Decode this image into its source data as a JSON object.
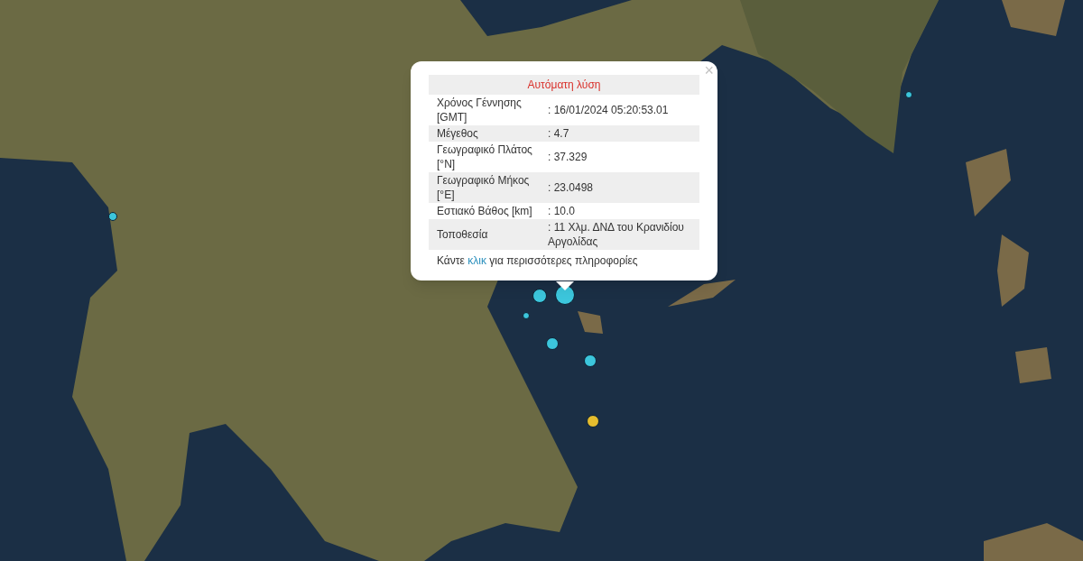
{
  "markers": [
    {
      "color": "#3cc6dc"
    },
    {
      "color": "#3cc6dc"
    },
    {
      "color": "#3cc6dc"
    },
    {
      "color": "#3cc6dc"
    },
    {
      "color": "#3cc6dc"
    },
    {
      "color": "#3cc6dc"
    },
    {
      "color": "#3cc6dc"
    },
    {
      "color": "#e6bd2e"
    }
  ],
  "popup": {
    "close": "×",
    "title": "Αυτόματη λύση",
    "rows": [
      {
        "label": "Χρόνος Γέννησης [GMT]",
        "value": ": 16/01/2024 05:20:53.01"
      },
      {
        "label": "Μέγεθος",
        "value": ": 4.7"
      },
      {
        "label": "Γεωγραφικό Πλάτος [°N]",
        "value": ": 37.329"
      },
      {
        "label": "Γεωγραφικό Μήκος [°E]",
        "value": ": 23.0498"
      },
      {
        "label": "Εστιακό Βάθος [km]",
        "value": ": 10.0"
      },
      {
        "label": "Τοποθεσία",
        "value": ": 11 Χλμ. ΔΝΔ του Κρανιδίου Αργολίδας"
      }
    ],
    "footer": {
      "before": "Κάντε",
      "link": "κλικ",
      "after": "για περισσότερες πληροφορίες"
    }
  }
}
